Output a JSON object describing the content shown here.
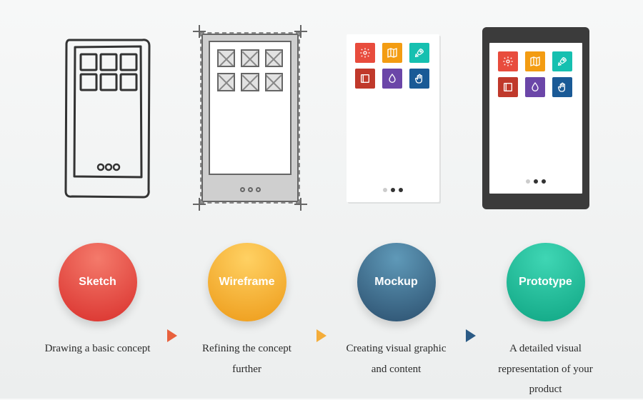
{
  "stages": [
    {
      "label": "Sketch",
      "desc": "Drawing a basic concept",
      "color": "#d9302c"
    },
    {
      "label": "Wireframe",
      "desc": "Refining the concept further",
      "color": "#ed9a18"
    },
    {
      "label": "Mockup",
      "desc": "Creating visual graphic and content",
      "color": "#2b4f6e"
    },
    {
      "label": "Prototype",
      "desc": "A detailed visual representation of your product",
      "color": "#0fa583"
    }
  ],
  "app_icons": [
    {
      "name": "gear-icon",
      "color": "#e84c3d"
    },
    {
      "name": "map-icon",
      "color": "#f39c12"
    },
    {
      "name": "rocket-icon",
      "color": "#16c0b0"
    },
    {
      "name": "book-icon",
      "color": "#c0392b"
    },
    {
      "name": "drop-icon",
      "color": "#6b46a8"
    },
    {
      "name": "hand-icon",
      "color": "#1a5a96"
    }
  ]
}
